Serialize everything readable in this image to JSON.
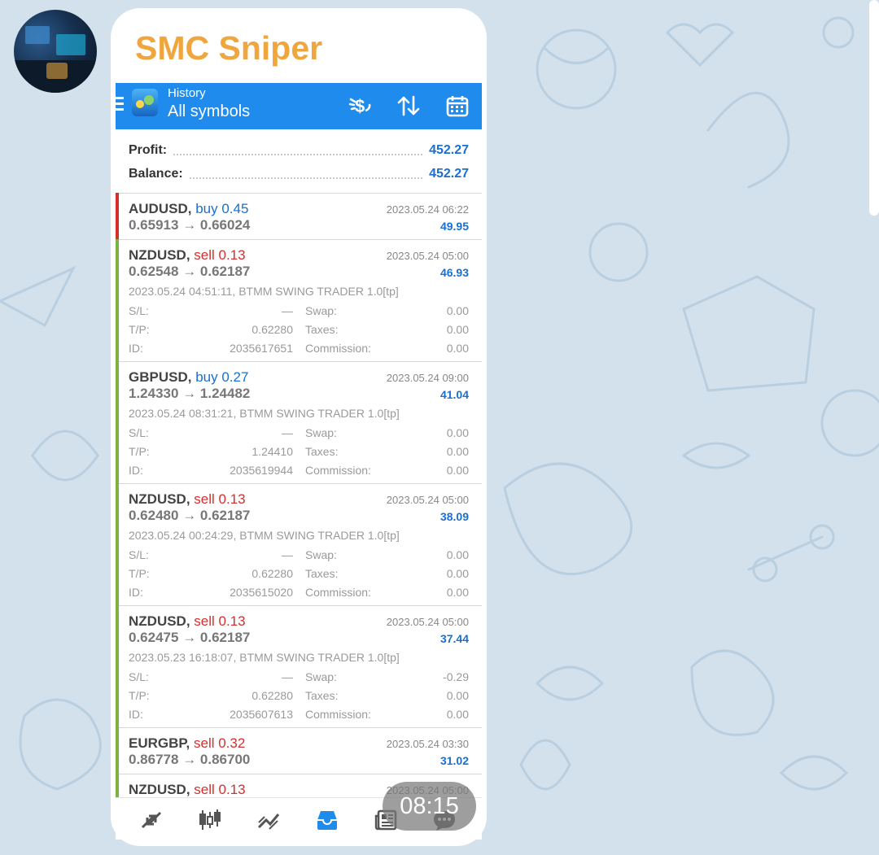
{
  "channel": {
    "sender_name": "SMC Sniper",
    "time": "08:15"
  },
  "app": {
    "title_small": "History",
    "title_big": "All symbols",
    "accent_color": "#1f8ced",
    "toolbar_icons": [
      "deposit-dollar-icon",
      "sort-arrows-icon",
      "calendar-icon"
    ]
  },
  "summary": {
    "profit_label": "Profit:",
    "profit_value": "452.27",
    "balance_label": "Balance:",
    "balance_value": "452.27"
  },
  "labels": {
    "sl": "S/L:",
    "tp": "T/P:",
    "id": "ID:",
    "swap": "Swap:",
    "taxes": "Taxes:",
    "commission": "Commission:"
  },
  "deals": [
    {
      "symbol": "AUDUSD,",
      "direction": "buy 0.45",
      "type": "buy",
      "open_price": "0.65913",
      "arrow": "→",
      "close_price": "0.66024",
      "time": "2023.05.24 06:22",
      "profit": "49.95",
      "bar_color": "#d32f2f"
    },
    {
      "symbol": "NZDUSD,",
      "direction": "sell 0.13",
      "type": "sell",
      "open_price": "0.62548",
      "arrow": "→",
      "close_price": "0.62187",
      "time": "2023.05.24 05:00",
      "profit": "46.93",
      "bar_color": "#7cb342",
      "comment": "2023.05.24 04:51:11, BTMM SWING TRADER 1.0[tp]",
      "sl": "—",
      "tp": "0.62280",
      "id": "2035617651",
      "swap": "0.00",
      "taxes": "0.00",
      "commission": "0.00"
    },
    {
      "symbol": "GBPUSD,",
      "direction": "buy 0.27",
      "type": "buy",
      "open_price": "1.24330",
      "arrow": "→",
      "close_price": "1.24482",
      "time": "2023.05.24 09:00",
      "profit": "41.04",
      "bar_color": "#7cb342",
      "comment": "2023.05.24 08:31:21, BTMM SWING TRADER 1.0[tp]",
      "sl": "—",
      "tp": "1.24410",
      "id": "2035619944",
      "swap": "0.00",
      "taxes": "0.00",
      "commission": "0.00"
    },
    {
      "symbol": "NZDUSD,",
      "direction": "sell 0.13",
      "type": "sell",
      "open_price": "0.62480",
      "arrow": "→",
      "close_price": "0.62187",
      "time": "2023.05.24 05:00",
      "profit": "38.09",
      "bar_color": "#7cb342",
      "comment": "2023.05.24 00:24:29, BTMM SWING TRADER 1.0[tp]",
      "sl": "—",
      "tp": "0.62280",
      "id": "2035615020",
      "swap": "0.00",
      "taxes": "0.00",
      "commission": "0.00"
    },
    {
      "symbol": "NZDUSD,",
      "direction": "sell 0.13",
      "type": "sell",
      "open_price": "0.62475",
      "arrow": "→",
      "close_price": "0.62187",
      "time": "2023.05.24 05:00",
      "profit": "37.44",
      "bar_color": "#7cb342",
      "comment": "2023.05.23 16:18:07, BTMM SWING TRADER 1.0[tp]",
      "sl": "—",
      "tp": "0.62280",
      "id": "2035607613",
      "swap": "-0.29",
      "taxes": "0.00",
      "commission": "0.00"
    },
    {
      "symbol": "EURGBP,",
      "direction": "sell 0.32",
      "type": "sell",
      "open_price": "0.86778",
      "arrow": "→",
      "close_price": "0.86700",
      "time": "2023.05.24 03:30",
      "profit": "31.02",
      "bar_color": "#7cb342"
    },
    {
      "symbol": "NZDUSD,",
      "direction": "sell 0.13",
      "type": "sell",
      "time": "2023.05.24 05:00",
      "bar_color": "#7cb342"
    }
  ],
  "bottom_nav": [
    "quotes-icon",
    "chart-icon",
    "trade-icon",
    "history-icon",
    "news-icon",
    "chat-icon"
  ]
}
